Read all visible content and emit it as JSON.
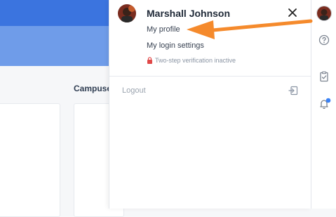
{
  "background": {
    "campus_label": "Campuses",
    "colors": {
      "header_top": "#3b74df",
      "header_band": "#6f9ce9",
      "content_bg": "#f6f7f9"
    }
  },
  "user_panel": {
    "name": "Marshall Johnson",
    "menu": [
      {
        "label": "My profile"
      },
      {
        "label": "My login settings"
      }
    ],
    "two_step_status": "Two-step verification inactive",
    "logout_label": "Logout",
    "icons": {
      "close": "close-icon",
      "lock": "lock-icon",
      "logout": "logout-icon"
    }
  },
  "right_rail": {
    "icons": [
      "avatar",
      "help-circle-icon",
      "clipboard-check-icon",
      "bell-icon"
    ],
    "notification_dot_color": "#3b82f6"
  },
  "annotation": {
    "arrow_color": "#f58a2c"
  }
}
